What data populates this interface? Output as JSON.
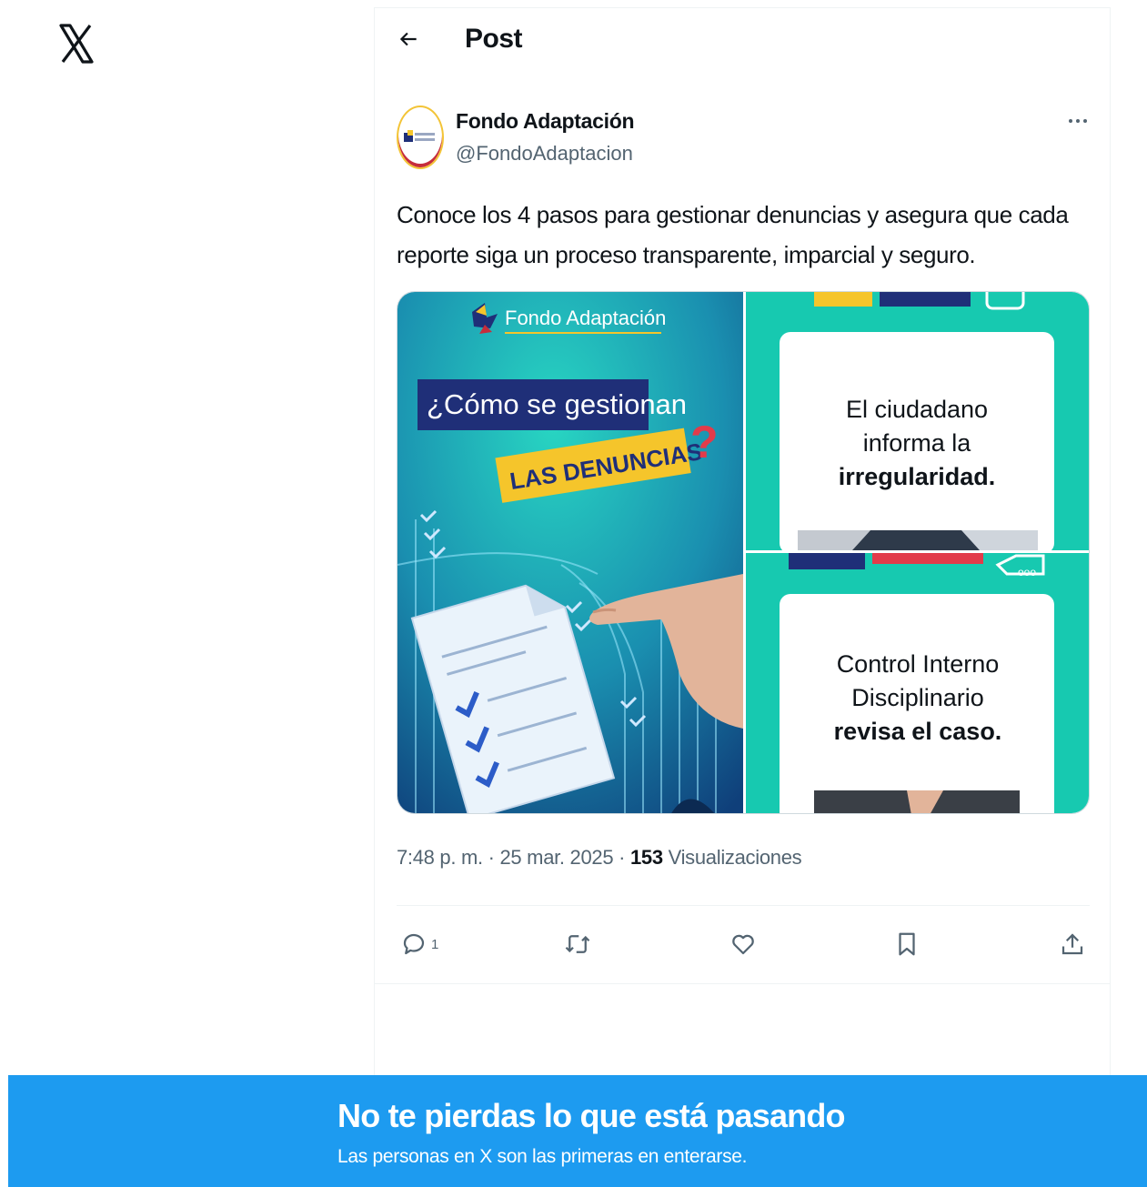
{
  "header": {
    "title": "Post"
  },
  "post": {
    "author_name": "Fondo Adaptación",
    "author_handle": "@FondoAdaptacion",
    "text": "Conoce los 4 pasos para gestionar denuncias y asegura que cada reporte siga un proceso transparente, imparcial y seguro.",
    "time": "7:48 p. m. · 25 mar. 2025 · ",
    "views_count": "153",
    "views_label": " Visualizaciones"
  },
  "media": {
    "left": {
      "brand": "Fondo Adaptación",
      "headline": "¿Cómo se gestionan",
      "highlight": "LAS DENUNCIAS",
      "question_mark": "?"
    },
    "top_right": {
      "line1": "El ciudadano",
      "line2": "informa la",
      "line3": "irregularidad."
    },
    "bottom_right": {
      "line1": "Control Interno",
      "line2": "Disciplinario",
      "line3": "revisa el caso."
    }
  },
  "actions": {
    "reply_count": "1"
  },
  "icons": [
    "x-logo-icon",
    "back-arrow-icon",
    "more-icon",
    "reply-icon",
    "repost-icon",
    "like-icon",
    "bookmark-icon",
    "share-icon"
  ],
  "banner": {
    "title": "No te pierdas lo que está pasando",
    "subtitle": "Las personas en X son las primeras en enterarse."
  },
  "colors": {
    "banner": "#1d9bf0",
    "teal": "#19c9b3",
    "yellow": "#f5c52b",
    "navy": "#1f2f78"
  }
}
